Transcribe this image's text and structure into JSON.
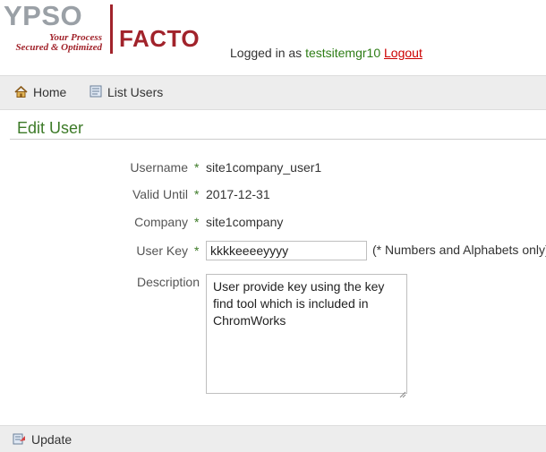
{
  "brand": {
    "logo_top": "YPSO",
    "tagline_line1": "Your Process",
    "tagline_line2": "Secured & Optimized",
    "logo_bottom": "FACTO"
  },
  "session": {
    "logged_in_prefix": "Logged in as",
    "username": "testsitemgr10",
    "logout_label": "Logout"
  },
  "nav": {
    "home_label": "Home",
    "list_users_label": "List Users"
  },
  "page": {
    "title": "Edit User"
  },
  "form": {
    "required_mark": "*",
    "username_label": "Username",
    "username_value": "site1company_user1",
    "valid_until_label": "Valid Until",
    "valid_until_value": "2017-12-31",
    "company_label": "Company",
    "company_value": "site1company",
    "user_key_label": "User Key",
    "user_key_value": "kkkkeeeeyyyy",
    "user_key_hint": "(* Numbers and Alphabets only)",
    "description_label": "Description",
    "description_value": "User provide key using the key find tool which is included in ChromWorks"
  },
  "actions": {
    "update_label": "Update"
  },
  "colors": {
    "brand_red": "#a1232b",
    "accent_green": "#3c7a27",
    "logout_red": "#cc0000"
  }
}
